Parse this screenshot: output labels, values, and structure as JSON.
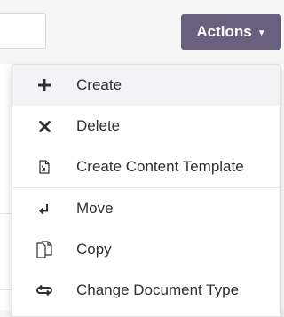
{
  "header": {
    "actions_label": "Actions"
  },
  "menu": {
    "items": [
      {
        "label": "Create",
        "icon": "plus-icon"
      },
      {
        "label": "Delete",
        "icon": "x-icon"
      },
      {
        "label": "Create Content Template",
        "icon": "document-template-icon"
      },
      {
        "label": "Move",
        "icon": "move-arrow-icon"
      },
      {
        "label": "Copy",
        "icon": "copy-icon"
      },
      {
        "label": "Change Document Type",
        "icon": "change-type-icon"
      }
    ]
  },
  "colors": {
    "actions_button": "#68607e",
    "highlight": "#f3f3f5",
    "text": "#303033"
  }
}
